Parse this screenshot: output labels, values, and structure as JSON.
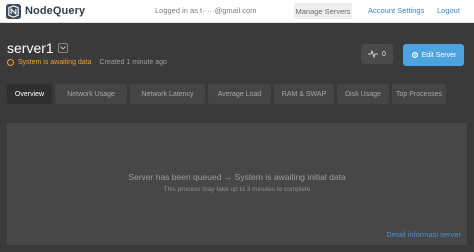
{
  "nav": {
    "brand": "NodeQuery",
    "logged_in_prefix": "Logged in as",
    "logged_in_email": "t·····@gmail.com",
    "manage_servers": "Manage Servers",
    "account_settings": "Account Settings",
    "logout": "Logout"
  },
  "server": {
    "name": "server1",
    "status": "System is awaiting data",
    "created": "Created 1 minute ago",
    "pulse_count": "0",
    "edit_label": "Edit Server"
  },
  "tabs": [
    {
      "label": "Overview",
      "active": true
    },
    {
      "label": "Network Usage",
      "active": false
    },
    {
      "label": "Network Latency",
      "active": false
    },
    {
      "label": "Average Load",
      "active": false
    },
    {
      "label": "RAM & SWAP",
      "active": false
    },
    {
      "label": "Disk Usage",
      "active": false
    },
    {
      "label": "Top Processes",
      "active": false
    }
  ],
  "panel": {
    "queued_message": "Server has been queued → System is awaiting initial data",
    "process_message": "This process may take up to 3 minutes to complete",
    "detail_link": "Detail informasi server"
  },
  "colors": {
    "background": "#3a3a3a",
    "accent": "#4da3e0",
    "status": "#f0a030"
  },
  "icons": {
    "brand": "nodequery-logo-icon",
    "dropdown": "chevron-down-icon",
    "status": "status-ring-icon",
    "pulse": "pulse-icon",
    "edit": "gear-icon"
  }
}
